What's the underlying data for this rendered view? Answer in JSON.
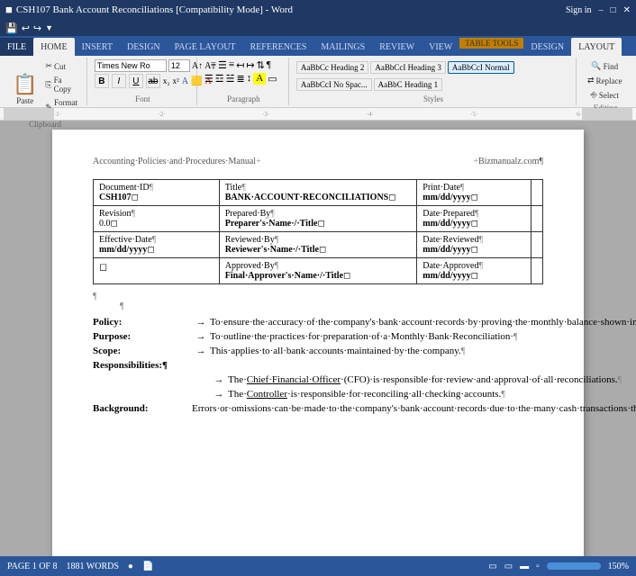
{
  "titlebar": {
    "title": "CSH107 Bank Account Reconciliations [Compatibility Mode] - Word",
    "sign_in": "Sign in"
  },
  "ribbon_tabs_extra": "TABLE TOOLS",
  "ribbon_tabs": [
    {
      "id": "file",
      "label": "FILE"
    },
    {
      "id": "home",
      "label": "HOME",
      "active": true
    },
    {
      "id": "insert",
      "label": "INSERT"
    },
    {
      "id": "design",
      "label": "DESIGN"
    },
    {
      "id": "page_layout",
      "label": "PAGE LAYOUT"
    },
    {
      "id": "references",
      "label": "REFERENCES"
    },
    {
      "id": "mailings",
      "label": "MAILINGS"
    },
    {
      "id": "review",
      "label": "REVIEW"
    },
    {
      "id": "view",
      "label": "VIEW"
    },
    {
      "id": "design2",
      "label": "DESIGN"
    },
    {
      "id": "layout",
      "label": "LAYOUT",
      "active": true
    }
  ],
  "clipboard": {
    "paste_label": "Paste",
    "cut_label": "Cut",
    "copy_label": "Fa Copy",
    "format_painter_label": "Format Painter",
    "group_label": "Clipboard"
  },
  "font_group": {
    "font_name": "Times New Ro",
    "font_size": "12",
    "group_label": "Font"
  },
  "paragraph_group": {
    "group_label": "Paragraph"
  },
  "styles_group": {
    "styles": [
      "Heading 2",
      "Heading 3",
      "Normal",
      "No Spac...",
      "Heading 1"
    ],
    "group_label": "Styles"
  },
  "editing_group": {
    "find_label": "Find",
    "replace_label": "Replace",
    "select_label": "Select",
    "group_label": "Editing"
  },
  "page_header": {
    "left": "Accounting·Policies·and·Procedures·Manual",
    "right": "Bizmanualz.com¶"
  },
  "table": {
    "rows": [
      {
        "col1": "Document·ID¶\nCSH107◻",
        "col2": "Title¶\nBANK·ACCOUNT·RECONCILIATIONs◻",
        "col3": "Print·Date¶\nmm/dd/yyyy◻"
      },
      {
        "col1": "Revision¶\n0.0◻",
        "col2": "Prepared·By¶\nPreparer's·Name·/·Title◻",
        "col3": "Date·Prepared¶\nmm/dd/yyyy◻"
      },
      {
        "col1": "Effective·Date¶\nmm/dd/yyyy◻",
        "col2": "Reviewed·By¶\nReviewer's·Name·/·Title◻",
        "col3": "Date·Reviewed¶\nmm/dd/yyyy◻"
      },
      {
        "col1": "◻",
        "col2": "Approved·By¶\nFinal·Approver's·Name·/·Title◻",
        "col3": "Date·Approved¶\nmm/dd/yyyy◻"
      }
    ]
  },
  "content": {
    "pilcrow": "¶",
    "policy_label": "Policy:",
    "policy_arrow": "→",
    "policy_text": "To·ensure·the·accuracy·of·the·company's·bank·account·records·by·proving·the·monthly·balance·shown·in·the·bank's·Account·Register.¶",
    "purpose_label": "Purpose:",
    "purpose_arrow": "→",
    "purpose_text": "To·outline·the·practices·for·preparation·of·a·Monthly·Bank·Reconciliation·¶",
    "scope_label": "Scope:",
    "scope_arrow": "→",
    "scope_text": "This·applies·to·all·bank·accounts·maintained·by·the·company.¶",
    "responsibilities_label": "Responsibilities:¶",
    "resp_arrow1": "→",
    "resp_text1": "The·Chief·Financial·Officer·(CFO)·is·responsible·for·review·and·approval·of·all·reconciliations.¶",
    "resp_arrow2": "→",
    "resp_text2": "The·Controller·is·responsible·for·reconciling·all·checking·accounts.¶",
    "background_label": "Background:",
    "background_text": "Errors·or·omissions·can·be·made·to·the·company's·bank·account·records·due·to·the·many·cash·transactions·that·occur.··Therefore,·it·is·necessary·to·prove·the·monthly·balance·shown·in·the·bank·account·register.··Cash·on·deposit·with·a·bank·is·not·available·for·count·and·is·therefore·proved·through·the·preparation·of·a·reconciliation·of·the·company's·record·of·cash·in·the·bank·and·the·bank's·record·of·the·company's·cash·that·is·on·"
  },
  "status": {
    "page_info": "PAGE 1 OF 8",
    "word_count": "1881 WORDS",
    "zoom": "150%"
  }
}
